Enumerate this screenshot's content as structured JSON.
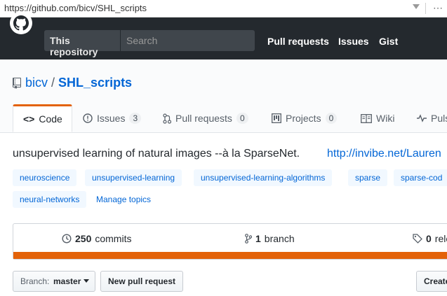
{
  "browser": {
    "url": "https://github.com/bicv/SHL_scripts"
  },
  "header": {
    "search_scope": "This repository",
    "search_placeholder": "Search",
    "nav": [
      "Pull requests",
      "Issues",
      "Gist"
    ]
  },
  "repo": {
    "owner": "bicv",
    "separator": "/",
    "name": "SHL_scripts"
  },
  "tabs": [
    {
      "label": "Code",
      "icon": "code-icon"
    },
    {
      "label": "Issues",
      "count": "3",
      "icon": "issue-icon"
    },
    {
      "label": "Pull requests",
      "count": "0",
      "icon": "pull-request-icon"
    },
    {
      "label": "Projects",
      "count": "0",
      "icon": "project-icon"
    },
    {
      "label": "Wiki",
      "icon": "wiki-icon"
    },
    {
      "label": "Puls",
      "icon": "pulse-icon"
    }
  ],
  "description": "unsupervised learning of natural images --à la SparseNet.",
  "homepage": "http://invibe.net/Lauren",
  "topics": [
    "neuroscience",
    "unsupervised-learning",
    "unsupervised-learning-algorithms",
    "sparse",
    "sparse-cod",
    "neural-networks"
  ],
  "manage_topics": "Manage topics",
  "summary": {
    "commits_count": "250",
    "commits_label": "commits",
    "branches_count": "1",
    "branches_label": "branch",
    "releases_count": "0",
    "releases_label": "rele"
  },
  "buttons": {
    "branch_prefix": "Branch:",
    "branch_name": "master",
    "new_pull_request": "New pull request",
    "create": "Create"
  },
  "colors": {
    "header_bg": "#24292e",
    "link": "#0366d6",
    "accent_orange": "#e36209"
  }
}
